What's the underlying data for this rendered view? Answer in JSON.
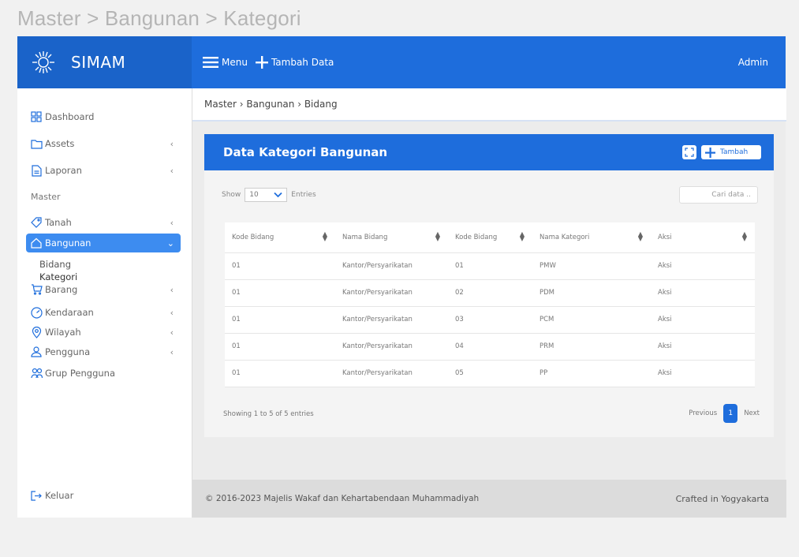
{
  "page_caption": "Master > Bangunan > Kategori",
  "brand": {
    "name": "SIMAM",
    "logo_icon": "sun-emblem-icon"
  },
  "topbar": {
    "menu_label": "Menu",
    "add_label": "Tambah Data",
    "user": "Admin"
  },
  "sidebar": {
    "items": [
      {
        "label": "Dashboard",
        "icon": "dashboard-icon"
      },
      {
        "label": "Assets",
        "icon": "folder-icon",
        "chevron": "‹"
      },
      {
        "label": "Laporan",
        "icon": "document-icon",
        "chevron": "‹"
      },
      {
        "label": "Tanah",
        "icon": "tag-icon",
        "chevron": "‹"
      },
      {
        "label": "Bangunan",
        "icon": "home-icon",
        "chevron": "⌄"
      },
      {
        "label": "Barang",
        "icon": "cart-icon",
        "chevron": "‹"
      },
      {
        "label": "Kendaraan",
        "icon": "speedometer-icon",
        "chevron": "‹"
      },
      {
        "label": "Wilayah",
        "icon": "location-pin-icon",
        "chevron": "‹"
      },
      {
        "label": "Pengguna",
        "icon": "user-icon",
        "chevron": "‹"
      },
      {
        "label": "Grup Pengguna",
        "icon": "users-group-icon"
      }
    ],
    "section_header": "Master",
    "subitems": [
      "Bidang",
      "Kategori"
    ],
    "logout": "Keluar"
  },
  "breadcrumb": "Master › Bangunan › Bidang",
  "card": {
    "title": "Data Kategori Bangunan",
    "add_button": "Tambah"
  },
  "datatable": {
    "show_label": "Show",
    "entries_value": "10",
    "entries_label": "Entries",
    "search_placeholder": "Cari data ..",
    "columns": [
      "Kode Bidang",
      "Nama Bidang",
      "Kode Bidang",
      "Nama Kategori",
      "Aksi"
    ],
    "rows": [
      [
        "01",
        "Kantor/Persyarikatan",
        "01",
        "PMW",
        "Aksi"
      ],
      [
        "01",
        "Kantor/Persyarikatan",
        "02",
        "PDM",
        "Aksi"
      ],
      [
        "01",
        "Kantor/Persyarikatan",
        "03",
        "PCM",
        "Aksi"
      ],
      [
        "01",
        "Kantor/Persyarikatan",
        "04",
        "PRM",
        "Aksi"
      ],
      [
        "01",
        "Kantor/Persyarikatan",
        "05",
        "PP",
        "Aksi"
      ]
    ],
    "info": "Showing 1 to 5 of 5 entries",
    "prev": "Previous",
    "current_page": "1",
    "next": "Next"
  },
  "footer": {
    "copyright": "© 2016-2023 Majelis Wakaf dan Kehartabendaan Muhammadiyah",
    "crafted": "Crafted in Yogyakarta"
  },
  "colors": {
    "primary": "#1e6ddc",
    "brand": "#1a63c9",
    "active": "#3d8cf0"
  }
}
